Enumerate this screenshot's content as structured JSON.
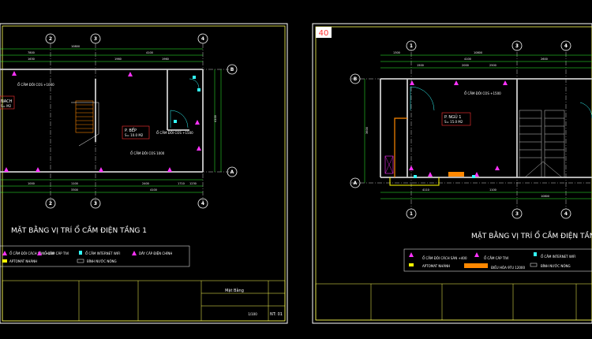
{
  "sheet_left": {
    "title": "MẶT BẰNG VỊ TRÍ Ổ CẮM ĐIỆN TẦNG 1",
    "room_kitchen": "P. BẾP",
    "room_kitchen_area": "S= 10.0 M2",
    "room_partial": "NACH",
    "room_partial_area": "S= M2",
    "outlet_note_1": "Ổ CẮM ĐÔI COS +1000",
    "outlet_note_2": "Ổ CẮM ĐÔI COS +1500",
    "outlet_note_3": "Ổ CẮM ĐÔI COS 1000",
    "grid": [
      "2",
      "3",
      "4",
      "B",
      "A"
    ],
    "legend": [
      "Ổ CẮM ĐÔI CÁCH SÀN +400",
      "Ổ CẮM CÁP TIVI",
      "Ổ CẮM INTERNET WIFI",
      "DÂY CÁP ĐIỆN CHÍNH",
      "APTOMAT NHÁNH",
      "BÌNH NƯỚC NÓNG"
    ],
    "title_block": {
      "sheet_name": "Mặt Bằng",
      "sheet_number": "NT: 01",
      "scale": "1/100"
    }
  },
  "sheet_right": {
    "badge": "40",
    "title": "MẶT BẰNG VỊ TRÍ Ổ CẮM ĐIỆN TẦNG",
    "room_bed": "P. NGỦ 1",
    "room_bed_area": "S= 15.0 M2",
    "outlet_note_1": "Ổ CẮM ĐÔI COS +1500",
    "grid": [
      "1",
      "3",
      "4",
      "B",
      "A"
    ],
    "legend": [
      "Ổ CẮM ĐÔI CÁCH SÀN +400",
      "Ổ CẮM CÁP TIVI",
      "Ổ CẮM INTERNET WIFI",
      "APTOMAT NHÁNH",
      "ĐIỀU HÒA 9TU 12000",
      "BÌNH NƯỚC NÓNG"
    ]
  },
  "colors": {
    "frame": "#ffffff",
    "border": "#ffff55",
    "wall": "#cccccc",
    "dim": "#33ff33",
    "outlet": "#ff33ff",
    "gridline": "#ffffff",
    "badge": "#ff3333",
    "cyan": "#33ffff",
    "orange": "#ff8800",
    "yellow": "#ffff00"
  }
}
